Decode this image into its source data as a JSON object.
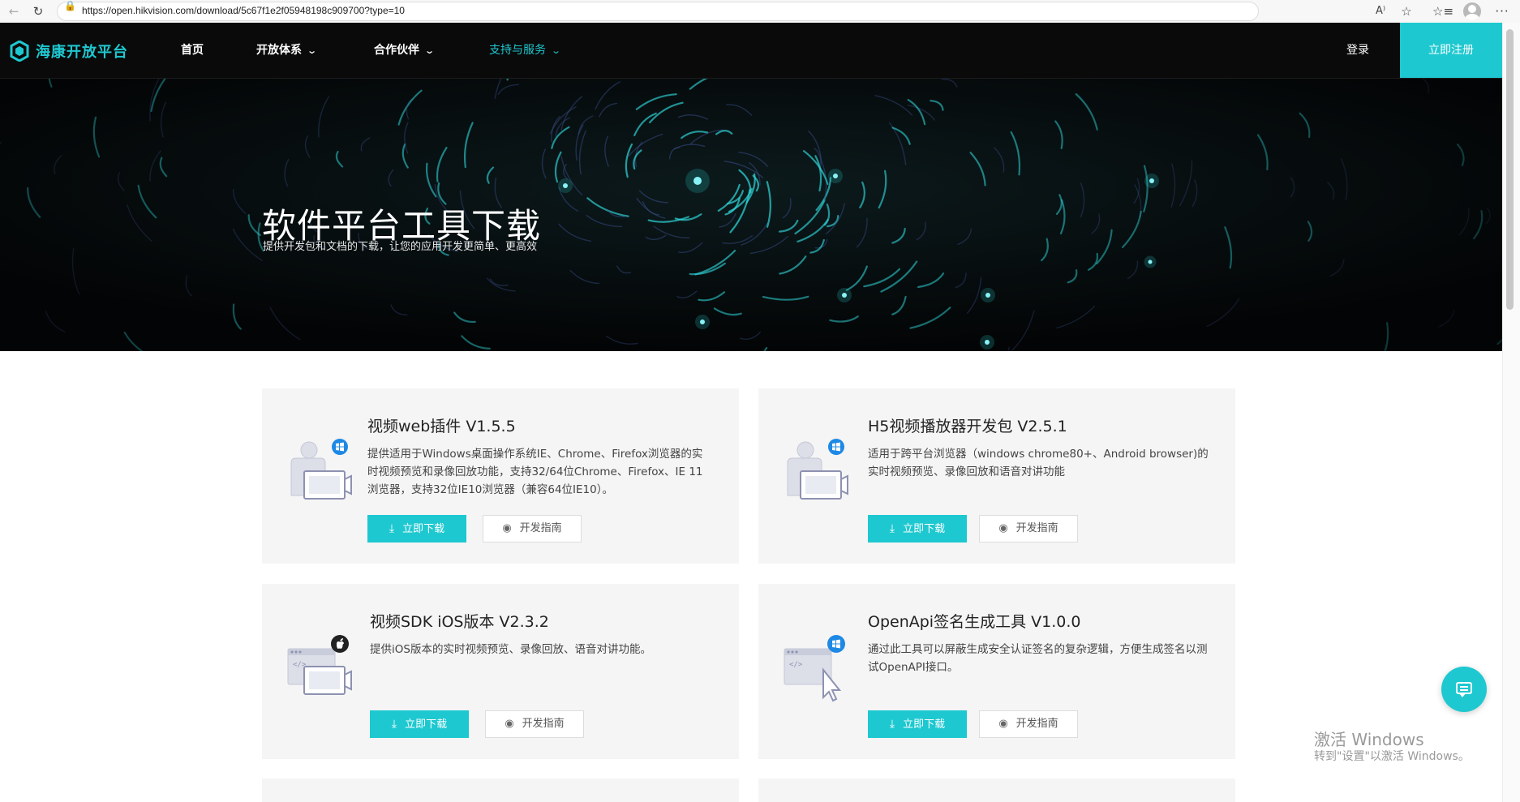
{
  "browser": {
    "url": "https://open.hikvision.com/download/5c67f1e2f05948198c909700?type=10",
    "back_icon": "←",
    "reload_icon": "↻",
    "lock_icon": "🔒",
    "read_aloud_icon": "A⁾",
    "favorite_icon": "☆",
    "favorites_icon": "☆≡",
    "menu_icon": "···"
  },
  "header": {
    "logo_text": "海康开放平台",
    "nav": [
      {
        "label": "首页",
        "chevron": ""
      },
      {
        "label": "开放体系",
        "chevron": "⌄"
      },
      {
        "label": "合作伙伴",
        "chevron": "⌄"
      },
      {
        "label": "支持与服务",
        "chevron": "⌄"
      }
    ],
    "login": "登录",
    "register": "立即注册"
  },
  "hero": {
    "title": "软件平台工具下载",
    "subtitle": "提供开发包和文档的下载，让您的应用开发更简单、更高效"
  },
  "cards": [
    {
      "title": "视频web插件 V1.5.5",
      "description": "提供适用于Windows桌面操作系统IE、Chrome、Firefox浏览器的实时视频预览和录像回放功能，支持32/64位Chrome、Firefox、IE 11浏览器，支持32位IE10浏览器（兼容64位IE10）。",
      "download": "立即下载",
      "guide": "开发指南",
      "icon": "windows-plugin-icon"
    },
    {
      "title": "H5视频播放器开发包 V2.5.1",
      "description": "适用于跨平台浏览器（windows chrome80+、Android browser)的实时视频预览、录像回放和语音对讲功能",
      "download": "立即下载",
      "guide": "开发指南",
      "icon": "windows-plugin-icon"
    },
    {
      "title": "视频SDK iOS版本 V2.3.2",
      "description": "提供iOS版本的实时视频预览、录像回放、语音对讲功能。",
      "download": "立即下载",
      "guide": "开发指南",
      "icon": "ios-sdk-icon"
    },
    {
      "title": "OpenApi签名生成工具 V1.0.0",
      "description": "通过此工具可以屏蔽生成安全认证签名的复杂逻辑，方便生成签名以测试OpenAPI接口。",
      "download": "立即下载",
      "guide": "开发指南",
      "icon": "windows-tool-icon"
    }
  ],
  "icons": {
    "download": "⤓",
    "guide": "◉"
  },
  "watermark": {
    "title": "激活 Windows",
    "subtitle": "转到\"设置\"以激活 Windows。"
  },
  "colors": {
    "accent": "#1ec8d0",
    "header_bg": "#0a0a0a",
    "card_bg": "#f5f5f5"
  }
}
